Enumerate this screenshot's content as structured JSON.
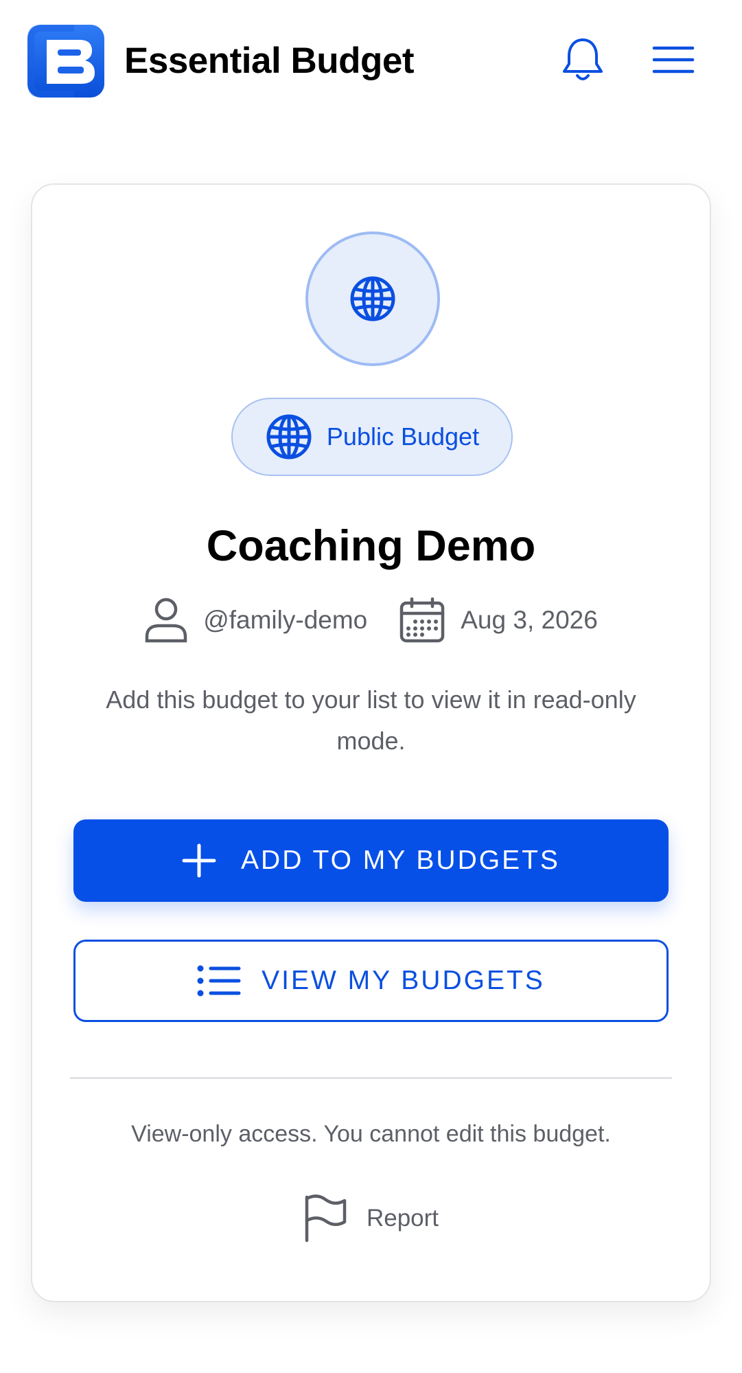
{
  "header": {
    "app_title": "Essential Budget",
    "logo_icon": "essential-budget-logo",
    "bell_icon": "bell-icon",
    "menu_icon": "hamburger-menu-icon"
  },
  "colors": {
    "accent": "#0650e8",
    "accent_text": "#0a4fe0",
    "chip_bg": "#e6eefc",
    "muted_text": "#5c5f66"
  },
  "budget": {
    "visibility_label": "Public Budget",
    "title": "Coaching Demo",
    "owner": "@family-demo",
    "date": "Aug 3, 2026",
    "description": "Add this budget to your list to view it in read-only mode."
  },
  "actions": {
    "add_label": "ADD TO MY BUDGETS",
    "view_label": "VIEW MY BUDGETS"
  },
  "footer": {
    "access_note": "View-only access. You cannot edit this budget.",
    "report_label": "Report"
  }
}
